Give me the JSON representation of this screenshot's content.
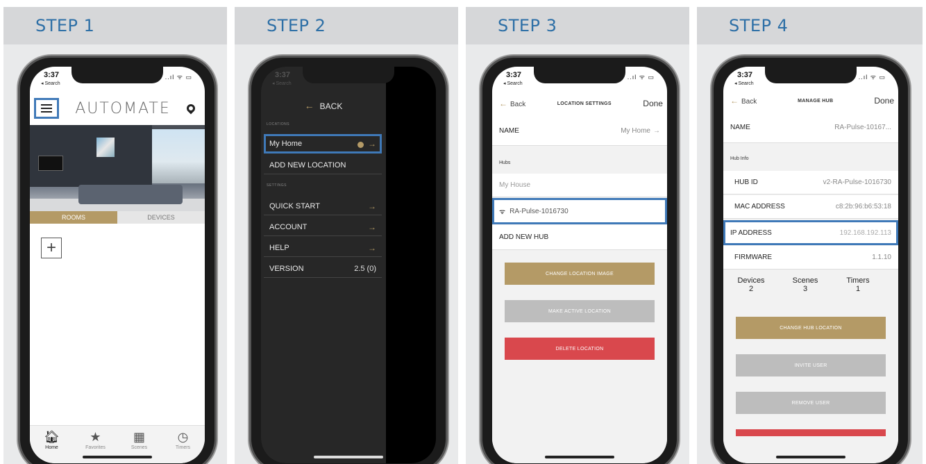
{
  "steps": [
    {
      "title": "STEP 1"
    },
    {
      "title": "STEP 2"
    },
    {
      "title": "STEP 3"
    },
    {
      "title": "STEP 4"
    }
  ],
  "status": {
    "time": "3:37",
    "back": "◂ Search",
    "icons": "..ıl ᯤ ▭"
  },
  "step1": {
    "brand": "AUTOMATE",
    "tabs": [
      "ROOMS",
      "DEVICES"
    ],
    "add_symbol": "+",
    "nav": [
      {
        "label": "Home",
        "icon": "home-icon"
      },
      {
        "label": "Favorites",
        "icon": "star-icon"
      },
      {
        "label": "Scenes",
        "icon": "film-icon"
      },
      {
        "label": "Timers",
        "icon": "clock-icon"
      }
    ],
    "icons": {
      "home": "🏠︎",
      "star": "★",
      "film": "▦",
      "clock": "◷"
    }
  },
  "step2": {
    "back_label": "BACK",
    "back_arrow": "←",
    "section_locations": "LOCATIONS",
    "my_home": "My Home",
    "add_location": "ADD NEW LOCATION",
    "section_settings": "SETTINGS",
    "quick_start": "QUICK START",
    "account": "ACCOUNT",
    "help": "HELP",
    "version_label": "VERSION",
    "version_value": "2.5 (0)",
    "chevron": "→"
  },
  "step3": {
    "back": "Back",
    "title": "LOCATION SETTINGS",
    "done": "Done",
    "name_label": "NAME",
    "name_value": "My Home",
    "hubs_label": "Hubs",
    "my_house": "My House",
    "hub_name": "RA-Pulse-1016730",
    "add_hub": "ADD NEW HUB",
    "btn_change_image": "CHANGE LOCATION IMAGE",
    "btn_make_active": "MAKE ACTIVE LOCATION",
    "btn_delete": "DELETE LOCATION"
  },
  "step4": {
    "back": "Back",
    "title": "MANAGE HUB",
    "done": "Done",
    "name_label": "NAME",
    "name_value": "RA-Pulse-10167...",
    "hub_info_label": "Hub Info",
    "hub_id_label": "HUB ID",
    "hub_id_value": "v2-RA-Pulse-1016730",
    "mac_label": "MAC ADDRESS",
    "mac_value": "c8:2b:96:b6:53:18",
    "ip_label": "IP ADDRESS",
    "ip_value": "192.168.192.113",
    "firmware_label": "FIRMWARE",
    "firmware_value": "1.1.10",
    "devices_label": "Devices",
    "devices_value": "2",
    "scenes_label": "Scenes",
    "scenes_value": "3",
    "timers_label": "Timers",
    "timers_value": "1",
    "btn_change_location": "CHANGE HUB LOCATION",
    "btn_invite": "INVITE USER",
    "btn_remove": "REMOVE USER"
  },
  "colors": {
    "accent_gold": "#b49a66",
    "highlight_blue": "#3f79b8",
    "step_blue": "#2d6fa6",
    "delete_red": "#d9484d"
  }
}
